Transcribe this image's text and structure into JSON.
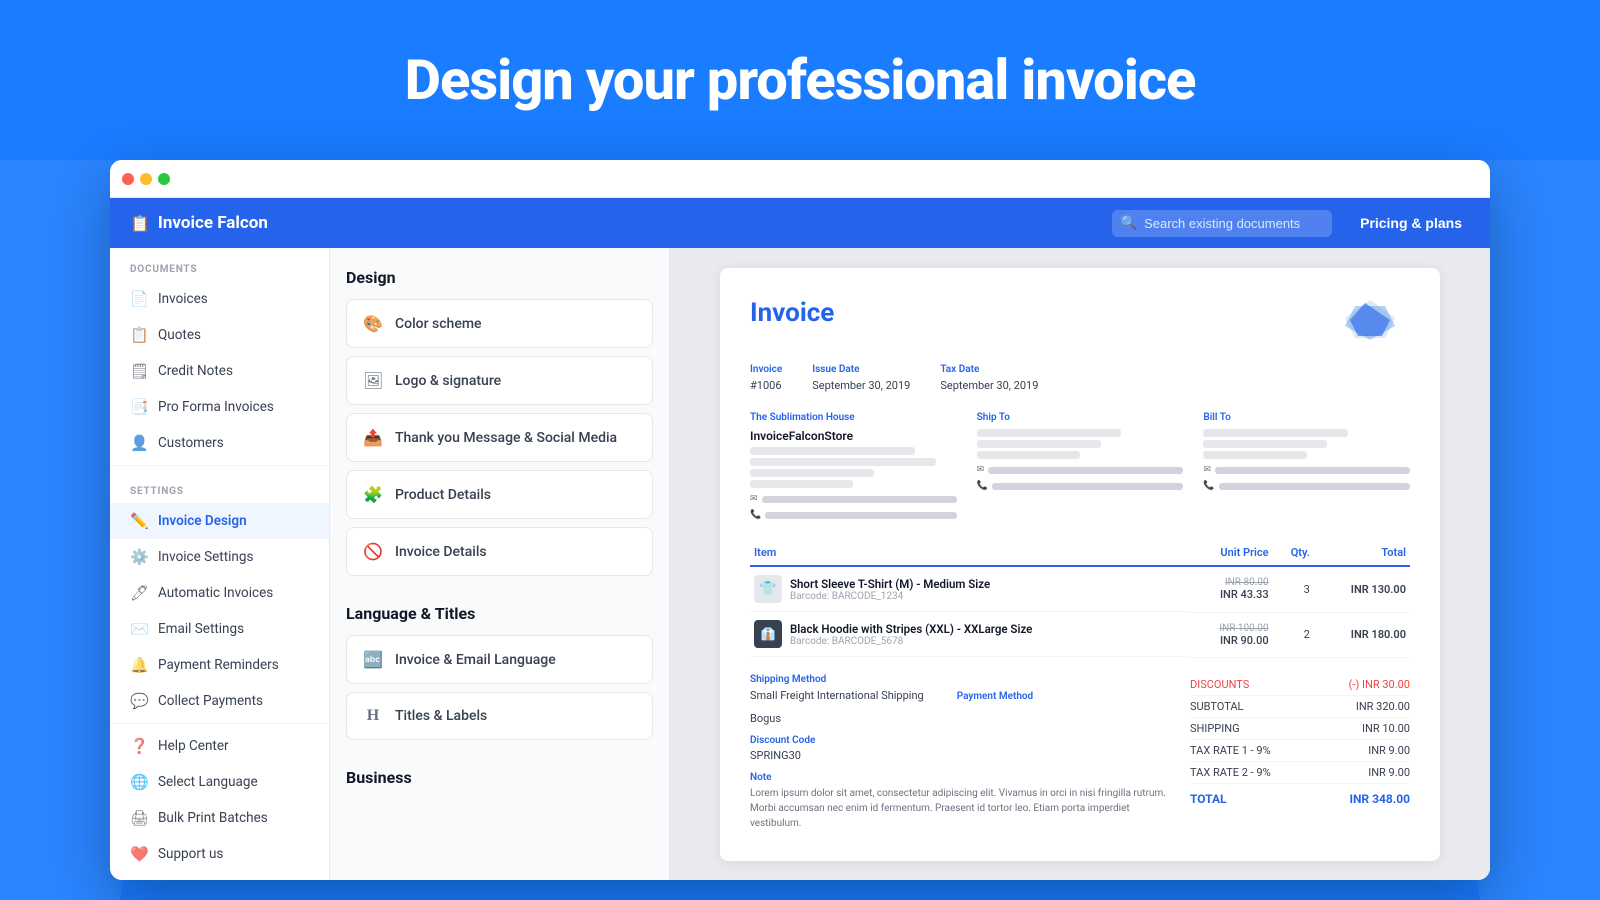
{
  "hero": {
    "title": "Design your professional invoice"
  },
  "header": {
    "logo": "Invoice Falcon",
    "search_placeholder": "Search existing documents",
    "pricing_label": "Pricing & plans"
  },
  "sidebar": {
    "documents_label": "DOCUMENTS",
    "settings_label": "SETTINGS",
    "items_documents": [
      {
        "id": "invoices",
        "label": "Invoices",
        "icon": "📄"
      },
      {
        "id": "quotes",
        "label": "Quotes",
        "icon": "📋"
      },
      {
        "id": "credit-notes",
        "label": "Credit Notes",
        "icon": "🗒"
      },
      {
        "id": "proforma",
        "label": "Pro Forma Invoices",
        "icon": "📑"
      },
      {
        "id": "customers",
        "label": "Customers",
        "icon": "👤"
      }
    ],
    "items_settings": [
      {
        "id": "invoice-design",
        "label": "Invoice Design",
        "icon": "✏️",
        "active": true
      },
      {
        "id": "invoice-settings",
        "label": "Invoice Settings",
        "icon": "⚙️"
      },
      {
        "id": "automatic-invoices",
        "label": "Automatic Invoices",
        "icon": "🖊"
      },
      {
        "id": "email-settings",
        "label": "Email Settings",
        "icon": "✉️"
      },
      {
        "id": "payment-reminders",
        "label": "Payment Reminders",
        "icon": "🔔"
      },
      {
        "id": "collect-payments",
        "label": "Collect Payments",
        "icon": "💬"
      }
    ],
    "items_other": [
      {
        "id": "help-center",
        "label": "Help Center",
        "icon": "❓"
      },
      {
        "id": "select-language",
        "label": "Select Language",
        "icon": "🌐"
      },
      {
        "id": "bulk-print",
        "label": "Bulk Print Batches",
        "icon": "🖨"
      },
      {
        "id": "support-us",
        "label": "Support us",
        "icon": "❤️"
      }
    ]
  },
  "design_panel": {
    "section_design": "Design",
    "design_items": [
      {
        "id": "color-scheme",
        "label": "Color scheme",
        "icon": "🎨"
      },
      {
        "id": "logo-signature",
        "label": "Logo & signature",
        "icon": "🖼"
      },
      {
        "id": "thank-you-message",
        "label": "Thank you Message & Social Media",
        "icon": "📤"
      },
      {
        "id": "product-details",
        "label": "Product Details",
        "icon": "🧩"
      },
      {
        "id": "invoice-details",
        "label": "Invoice Details",
        "icon": "🚫"
      }
    ],
    "section_language": "Language & Titles",
    "language_items": [
      {
        "id": "invoice-email-language",
        "label": "Invoice & Email Language",
        "icon": "🔤"
      },
      {
        "id": "titles-labels",
        "label": "Titles & Labels",
        "icon": "H"
      }
    ],
    "section_business": "Business"
  },
  "invoice": {
    "title": "Invoice",
    "number_label": "Invoice",
    "number": "#1006",
    "issue_date_label": "Issue Date",
    "issue_date": "September 30, 2019",
    "tax_date_label": "Tax Date",
    "tax_date": "September 30, 2019",
    "from_label": "The Sublimation House",
    "from_name": "InvoiceFalconStore",
    "ship_to_label": "Ship To",
    "bill_to_label": "Bill To",
    "table_headers": {
      "item": "Item",
      "unit_price": "Unit Price",
      "qty": "Qty.",
      "total": "Total"
    },
    "items": [
      {
        "name": "Short Sleeve T-Shirt (M) - Medium Size",
        "barcode": "Barcode: BARCODE_1234",
        "original_price": "INR 80.00",
        "price": "INR 43.33",
        "qty": "3",
        "total": "INR 130.00",
        "icon": "👕"
      },
      {
        "name": "Black Hoodie with Stripes (XXL) - XXLarge Size",
        "barcode": "Barcode: BARCODE_5678",
        "original_price": "INR 100.00",
        "price": "INR 90.00",
        "qty": "2",
        "total": "INR 180.00",
        "icon": "👔",
        "dark": true
      }
    ],
    "shipping_method_label": "Shipping Method",
    "shipping_method": "Small Freight International Shipping",
    "payment_method_label": "Payment Method",
    "payment_method": "Bogus",
    "discount_code_label": "Discount Code",
    "discount_code": "SPRING30",
    "note_label": "Note",
    "note_text": "Lorem ipsum dolor sit amet, consectetur adipiscing elit. Vivamus in orci in nisi fringilla rutrum. Morbi accumsan nec enim id fermentum. Praesent id tortor leo. Etiam porta imperdiet vestibulum.",
    "totals": {
      "discounts_label": "DISCOUNTS",
      "discounts_val": "(-) INR 30.00",
      "subtotal_label": "SUBTOTAL",
      "subtotal_val": "INR 320.00",
      "shipping_label": "SHIPPING",
      "shipping_val": "INR 10.00",
      "tax1_label": "TAX RATE 1 - 9%",
      "tax1_val": "INR 9.00",
      "tax2_label": "TAX RATE 2 - 9%",
      "tax2_val": "INR 9.00",
      "total_label": "TOTAL",
      "total_val": "INR 348.00"
    }
  }
}
